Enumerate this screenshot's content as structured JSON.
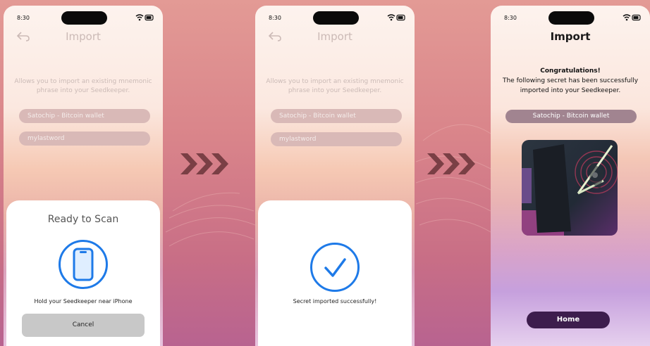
{
  "status": {
    "time": "8:30"
  },
  "screen1": {
    "title": "Import",
    "description": "Allows you to import an existing mnemonic phrase into your Seedkeeper.",
    "field_label": "Satochip - Bitcoin wallet",
    "field_phrase": "mylastword",
    "sheet_title": "Ready to Scan",
    "sheet_message": "Hold your Seedkeeper near iPhone",
    "cancel_label": "Cancel"
  },
  "screen2": {
    "title": "Import",
    "description": "Allows you to import an existing mnemonic phrase into your Seedkeeper.",
    "field_label": "Satochip - Bitcoin wallet",
    "field_phrase": "mylastword",
    "sheet_message": "Secret imported successfully!"
  },
  "screen3": {
    "title": "Import",
    "congrats_heading": "Congratulations!",
    "congrats_text": "The following secret has been successfully imported into your Seedkeeper.",
    "secret_label": "Satochip - Bitcoin wallet",
    "home_label": "Home"
  },
  "icons": [
    "back-arrow-icon",
    "wifi-icon",
    "battery-icon",
    "phone-icon",
    "checkmark-icon",
    "chevron-right-icon"
  ],
  "colors": {
    "accent": "#1e7ae8",
    "home_button": "#3d1d4d",
    "chevron": "#7a3f45"
  }
}
